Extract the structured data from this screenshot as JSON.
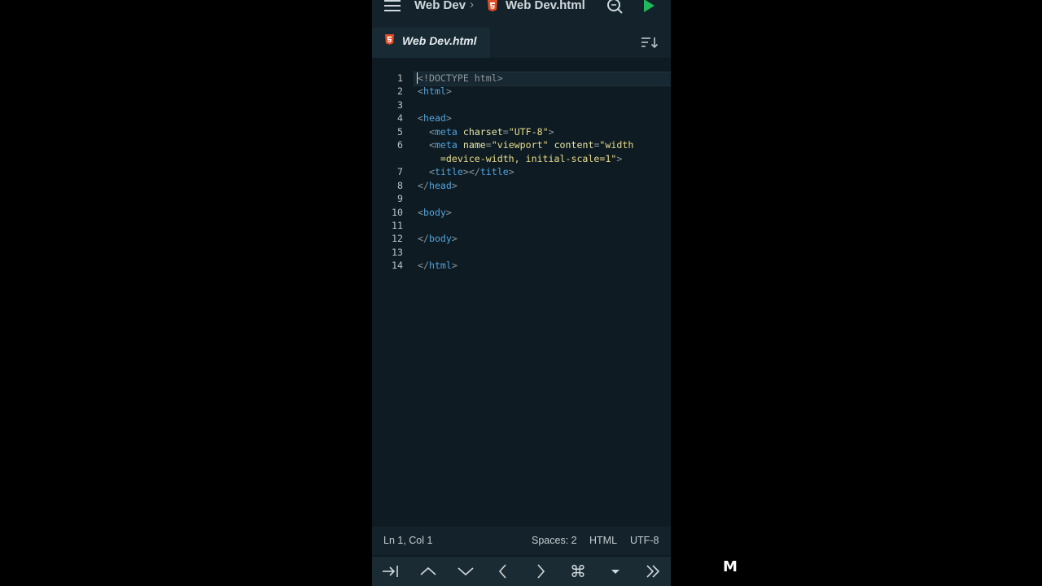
{
  "header": {
    "project": "Web Dev",
    "file": "Web Dev.html"
  },
  "tab": {
    "label": "Web Dev.html"
  },
  "editor": {
    "lines": [
      {
        "num": "1",
        "tokens": [
          [
            "doc",
            "<!DOCTYPE html>"
          ]
        ]
      },
      {
        "num": "2",
        "tokens": [
          [
            "punc",
            "<"
          ],
          [
            "tag",
            "html"
          ],
          [
            "punc",
            ">"
          ]
        ]
      },
      {
        "num": "3",
        "tokens": []
      },
      {
        "num": "4",
        "tokens": [
          [
            "punc",
            "<"
          ],
          [
            "tag",
            "head"
          ],
          [
            "punc",
            ">"
          ]
        ]
      },
      {
        "num": "5",
        "tokens": [
          [
            "plain",
            "  "
          ],
          [
            "punc",
            "<"
          ],
          [
            "tag",
            "meta"
          ],
          [
            "plain",
            " "
          ],
          [
            "attr",
            "charset"
          ],
          [
            "punc",
            "="
          ],
          [
            "str",
            "\"UTF-8\""
          ],
          [
            "punc",
            ">"
          ]
        ]
      },
      {
        "num": "6",
        "tokens": [
          [
            "plain",
            "  "
          ],
          [
            "punc",
            "<"
          ],
          [
            "tag",
            "meta"
          ],
          [
            "plain",
            " "
          ],
          [
            "attr",
            "name"
          ],
          [
            "punc",
            "="
          ],
          [
            "str",
            "\"viewport\""
          ],
          [
            "plain",
            " "
          ],
          [
            "attr",
            "content"
          ],
          [
            "punc",
            "="
          ],
          [
            "str",
            "\"width"
          ]
        ]
      },
      {
        "num": "",
        "tokens": [
          [
            "plain",
            "    "
          ],
          [
            "str",
            "=device-width, initial-scale=1\""
          ],
          [
            "punc",
            ">"
          ]
        ]
      },
      {
        "num": "7",
        "tokens": [
          [
            "plain",
            "  "
          ],
          [
            "punc",
            "<"
          ],
          [
            "tag",
            "title"
          ],
          [
            "punc",
            "></"
          ],
          [
            "tag",
            "title"
          ],
          [
            "punc",
            ">"
          ]
        ]
      },
      {
        "num": "8",
        "tokens": [
          [
            "punc",
            "</"
          ],
          [
            "tag",
            "head"
          ],
          [
            "punc",
            ">"
          ]
        ]
      },
      {
        "num": "9",
        "tokens": []
      },
      {
        "num": "10",
        "tokens": [
          [
            "punc",
            "<"
          ],
          [
            "tag",
            "body"
          ],
          [
            "punc",
            ">"
          ]
        ]
      },
      {
        "num": "11",
        "tokens": []
      },
      {
        "num": "12",
        "tokens": [
          [
            "punc",
            "</"
          ],
          [
            "tag",
            "body"
          ],
          [
            "punc",
            ">"
          ]
        ]
      },
      {
        "num": "13",
        "tokens": []
      },
      {
        "num": "14",
        "tokens": [
          [
            "punc",
            "</"
          ],
          [
            "tag",
            "html"
          ],
          [
            "punc",
            ">"
          ]
        ]
      }
    ]
  },
  "status": {
    "position": "Ln 1, Col 1",
    "indent": "Spaces: 2",
    "language": "HTML",
    "encoding": "UTF-8"
  },
  "keys": [
    "tab-icon",
    "arrow-up-icon",
    "arrow-down-icon",
    "arrow-left-icon",
    "arrow-right-icon",
    "command-icon",
    "dropdown-icon",
    "double-chevron-right-icon"
  ],
  "watermark": "M",
  "colors": {
    "background": "#0f1b22",
    "html5_icon": "#e44d26",
    "run": "#1fb85a",
    "tag": "#4fa3dd",
    "attribute": "#e6e6a8",
    "string": "#e6dc8a"
  }
}
